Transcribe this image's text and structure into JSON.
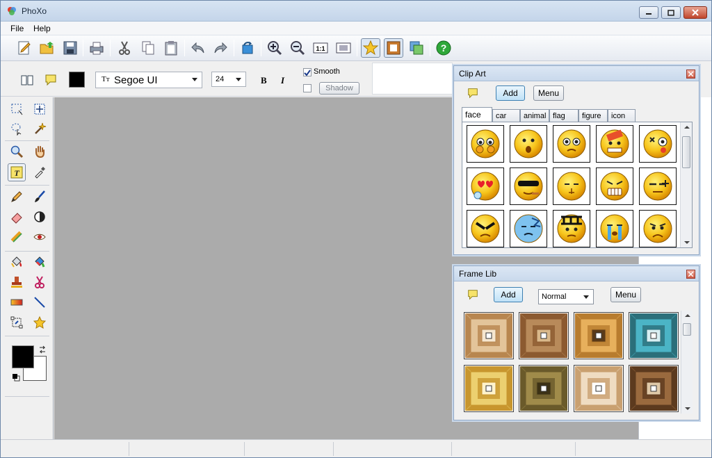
{
  "window": {
    "title": "PhoXo"
  },
  "menu": {
    "items": [
      "File",
      "Help"
    ]
  },
  "toolbar": {
    "buttons": [
      "new-icon",
      "open-icon",
      "save-icon",
      "print-icon",
      "cut-icon",
      "copy-icon",
      "paste-icon",
      "undo-icon",
      "redo-icon",
      "rotate-icon",
      "zoom-in-icon",
      "zoom-out-icon",
      "actual-size-icon",
      "fit-window-icon",
      "clipart-icon",
      "frame-icon",
      "layers-icon",
      "help-icon"
    ],
    "actual_size_label": "1:1"
  },
  "text_props": {
    "font_name": "Segoe UI",
    "font_size": "24",
    "bold_label": "B",
    "italic_label": "I",
    "smooth_label": "Smooth",
    "smooth_checked": true,
    "shadow_label": "Shadow",
    "shadow_checked": false,
    "color": "#000000"
  },
  "colors": {
    "foreground": "#000000",
    "background": "#ffffff",
    "panel_border": "#8fa7c5",
    "accent_blue": "#3c7fb1"
  },
  "clipart": {
    "title": "Clip Art",
    "add_label": "Add",
    "menu_label": "Menu",
    "tabs": [
      "face",
      "car",
      "animal",
      "flag",
      "figure",
      "icon"
    ],
    "selected_tab": "face",
    "items": [
      {
        "name": "face-shy-icon",
        "face": "shy"
      },
      {
        "name": "face-surprised-icon",
        "face": "surprised"
      },
      {
        "name": "face-worried-icon",
        "face": "worried"
      },
      {
        "name": "face-bandage-icon",
        "face": "bandage"
      },
      {
        "name": "face-hurt-icon",
        "face": "hurt"
      },
      {
        "name": "face-love-icon",
        "face": "love"
      },
      {
        "name": "face-cool-icon",
        "face": "cool"
      },
      {
        "name": "face-thinking-icon",
        "face": "thinking"
      },
      {
        "name": "face-grin-icon",
        "face": "grin"
      },
      {
        "name": "face-smug-icon",
        "face": "smug"
      },
      {
        "name": "face-angry-icon",
        "face": "angry"
      },
      {
        "name": "face-cold-icon",
        "face": "cold"
      },
      {
        "name": "face-writing-icon",
        "face": "writing"
      },
      {
        "name": "face-crying-icon",
        "face": "crying"
      },
      {
        "name": "face-sad-icon",
        "face": "sad"
      }
    ]
  },
  "framelib": {
    "title": "Frame Lib",
    "add_label": "Add",
    "menu_label": "Menu",
    "mode": "Normal",
    "frames": [
      {
        "name": "frame-wood-light",
        "outer": "#b8864f",
        "mid": "#e3c49a",
        "inner": "#f5e6cf"
      },
      {
        "name": "frame-wood-brown",
        "outer": "#8c5a30",
        "mid": "#b88a5a",
        "inner": "#d9b88a"
      },
      {
        "name": "frame-gold-tunnel",
        "outer": "#b87c2e",
        "mid": "#e7b05c",
        "inner": "#5a3a18"
      },
      {
        "name": "frame-teal-ornate",
        "outer": "#2b6f7a",
        "mid": "#4bb4c6",
        "inner": "#d8eef2"
      },
      {
        "name": "frame-gold-ornate",
        "outer": "#c8962e",
        "mid": "#ecd070",
        "inner": "#fff3cc"
      },
      {
        "name": "frame-olive-wood",
        "outer": "#6a5a2a",
        "mid": "#a08b4a",
        "inner": "#3c3115"
      },
      {
        "name": "frame-lace-pattern",
        "outer": "#c9a070",
        "mid": "#efdcc2",
        "inner": "#ffffff"
      },
      {
        "name": "frame-dark-wood",
        "outer": "#5c3a1e",
        "mid": "#9a6a3e",
        "inner": "#e0c9a8"
      }
    ]
  },
  "status": {
    "segments": [
      "",
      "",
      "",
      "",
      "",
      ""
    ]
  }
}
